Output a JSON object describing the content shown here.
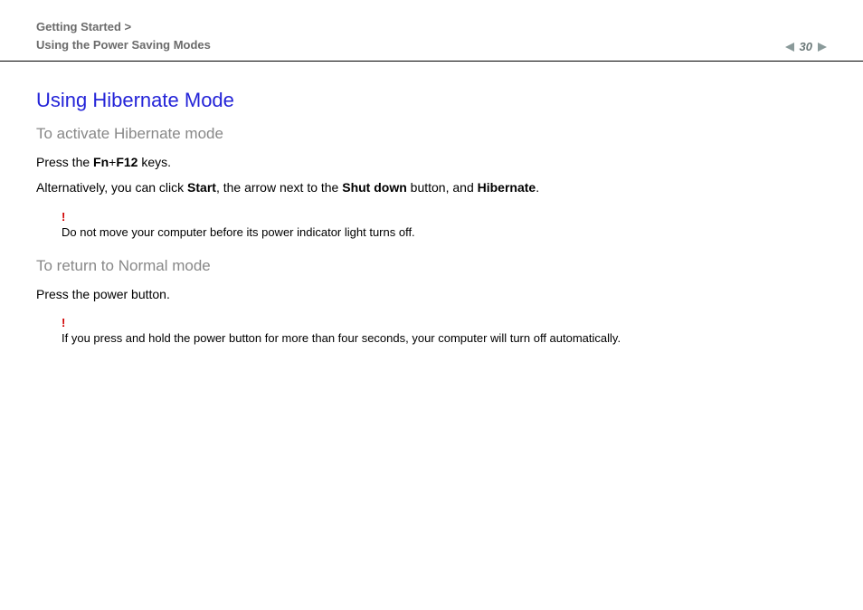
{
  "header": {
    "breadcrumb_line1": "Getting Started >",
    "breadcrumb_line2": "Using the Power Saving Modes",
    "page_number": "30"
  },
  "content": {
    "section_title": "Using Hibernate Mode",
    "subsection1": {
      "title": "To activate Hibernate mode",
      "line1_prefix": "Press the ",
      "line1_key1": "Fn",
      "line1_plus": "+",
      "line1_key2": "F12",
      "line1_suffix": " keys.",
      "line2_part1": "Alternatively, you can click ",
      "line2_bold1": "Start",
      "line2_part2": ", the arrow next to the ",
      "line2_bold2": "Shut down",
      "line2_part3": " button, and ",
      "line2_bold3": "Hibernate",
      "line2_part4": "."
    },
    "warning1": {
      "mark": "!",
      "text": "Do not move your computer before its power indicator light turns off."
    },
    "subsection2": {
      "title": "To return to Normal mode",
      "line1": "Press the power button."
    },
    "warning2": {
      "mark": "!",
      "text": "If you press and hold the power button for more than four seconds, your computer will turn off automatically."
    }
  }
}
